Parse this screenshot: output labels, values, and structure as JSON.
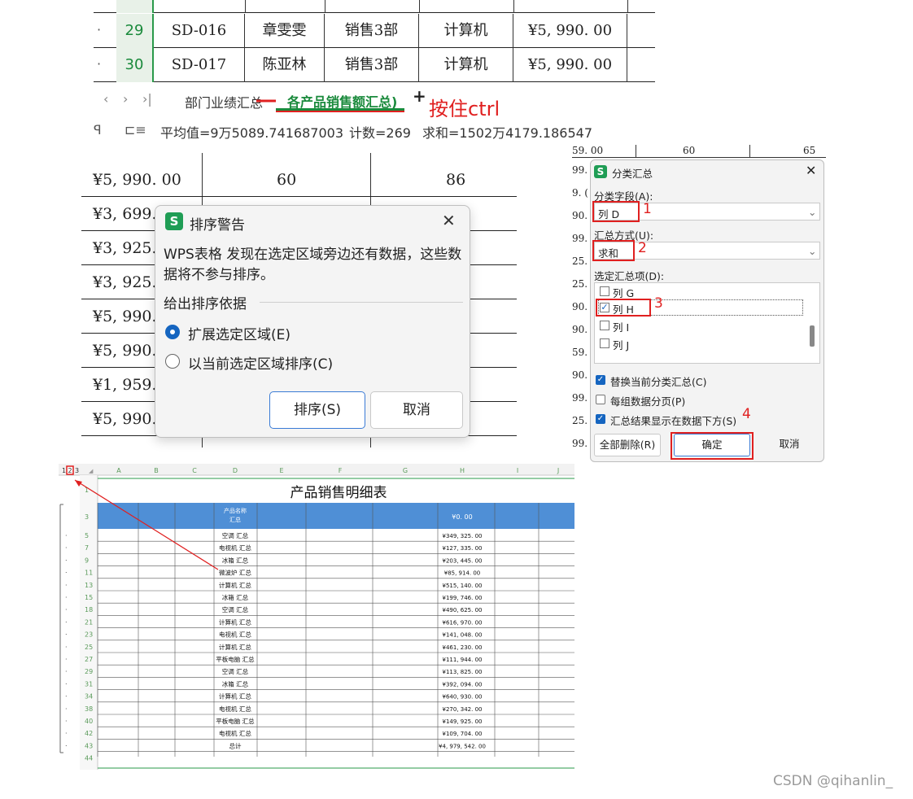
{
  "panel1": {
    "rows": [
      {
        "row": "29",
        "code": "SD-016",
        "name": "章雯雯",
        "dept": "销售3部",
        "product": "计算机",
        "amount": "¥5, 990. 00"
      },
      {
        "row": "30",
        "code": "SD-017",
        "name": "陈亚林",
        "dept": "销售3部",
        "product": "计算机",
        "amount": "¥5, 990. 00"
      }
    ],
    "tabs": {
      "tab1": "部门业绩汇总",
      "tab2": "各产品销售额汇总)",
      "add": "+",
      "annotation": "按住ctrl"
    },
    "status": {
      "avg": "平均值=9万5089.741687003",
      "count": "计数=269",
      "sum": "求和=1502万4179.186547"
    }
  },
  "panel2": {
    "first_row": {
      "value": "¥5, 990. 00",
      "col2": "60",
      "col3": "86"
    },
    "left_values": [
      "¥3, 699.",
      "¥3, 925.",
      "¥3, 925.",
      "¥5, 990.",
      "¥5, 990.",
      "¥1, 959.",
      "¥5, 990."
    ],
    "dialog": {
      "title": "排序警告",
      "message": "WPS表格 发现在选定区域旁边还有数据，这些数据将不参与排序。",
      "section": "给出排序依据",
      "option1": "扩展选定区域(E)",
      "option2": "以当前选定区域排序(C)",
      "sort_button": "排序(S)",
      "cancel_button": "取消"
    }
  },
  "panel3": {
    "bg_top": [
      "59. 00",
      "60",
      "65"
    ],
    "bg_left": [
      "99.",
      "9. (",
      "90.",
      "99.",
      "25.",
      "25.",
      "90.",
      "90.",
      "59.",
      "90.",
      "99.",
      "25.",
      "99."
    ],
    "dialog": {
      "title": "分类汇总",
      "field_label": "分类字段(A):",
      "field_value": "列 D",
      "method_label": "汇总方式(U):",
      "method_value": "求和",
      "items_label": "选定汇总项(D):",
      "items": [
        {
          "label": "列 G",
          "checked": false
        },
        {
          "label": "列 H",
          "checked": true
        },
        {
          "label": "列 I",
          "checked": false
        },
        {
          "label": "列 J",
          "checked": false
        }
      ],
      "opt_replace": "替换当前分类汇总(C)",
      "opt_pagebreak": "每组数据分页(P)",
      "opt_below": "汇总结果显示在数据下方(S)",
      "remove_all": "全部删除(R)",
      "ok": "确定",
      "cancel": "取消",
      "marks": [
        "1",
        "2",
        "3",
        "4"
      ]
    }
  },
  "panel4": {
    "levels": [
      "1",
      "2",
      "3"
    ],
    "col_headers": [
      "A",
      "B",
      "C",
      "D",
      "E",
      "F",
      "G",
      "H",
      "I",
      "J"
    ],
    "title": "产品销售明细表",
    "header_name": "产品名称",
    "header_name2": "汇总",
    "header_total": "¥0. 00",
    "rows": [
      {
        "row": "5",
        "name": "空调 汇总",
        "value": "¥349, 325. 00"
      },
      {
        "row": "7",
        "name": "电视机 汇总",
        "value": "¥127, 335. 00"
      },
      {
        "row": "9",
        "name": "冰箱 汇总",
        "value": "¥203, 445. 00"
      },
      {
        "row": "11",
        "name": "微波炉 汇总",
        "value": "¥85, 914. 00"
      },
      {
        "row": "13",
        "name": "计算机 汇总",
        "value": "¥515, 140. 00"
      },
      {
        "row": "15",
        "name": "冰箱 汇总",
        "value": "¥199, 746. 00"
      },
      {
        "row": "18",
        "name": "空调 汇总",
        "value": "¥490, 625. 00"
      },
      {
        "row": "21",
        "name": "计算机 汇总",
        "value": "¥616, 970. 00"
      },
      {
        "row": "23",
        "name": "电视机 汇总",
        "value": "¥141, 048. 00"
      },
      {
        "row": "25",
        "name": "计算机 汇总",
        "value": "¥461, 230. 00"
      },
      {
        "row": "27",
        "name": "平板电脑 汇总",
        "value": "¥111, 944. 00"
      },
      {
        "row": "29",
        "name": "空调 汇总",
        "value": "¥113, 825. 00"
      },
      {
        "row": "31",
        "name": "冰箱 汇总",
        "value": "¥392, 094. 00"
      },
      {
        "row": "34",
        "name": "计算机 汇总",
        "value": "¥640, 930. 00"
      },
      {
        "row": "38",
        "name": "电视机 汇总",
        "value": "¥270, 342. 00"
      },
      {
        "row": "40",
        "name": "平板电脑 汇总",
        "value": "¥149, 925. 00"
      },
      {
        "row": "42",
        "name": "电视机 汇总",
        "value": "¥109, 704. 00"
      },
      {
        "row": "43",
        "name": "总计",
        "value": "¥4, 979, 542. 00"
      }
    ],
    "extra_rows": [
      "1",
      "3",
      "44"
    ]
  },
  "watermark": "CSDN @qihanlin_"
}
